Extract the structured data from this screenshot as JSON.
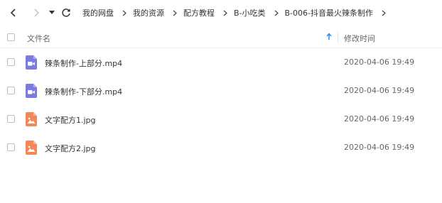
{
  "breadcrumb": [
    "我的网盘",
    "我的资源",
    "配方教程",
    "B-小吃类",
    "B-006-抖音最火辣条制作"
  ],
  "columns": {
    "name": "文件名",
    "modified": "修改时间"
  },
  "files": [
    {
      "name": "辣条制作-上部分.mp4",
      "modified": "2020-04-06 19:49",
      "type": "video"
    },
    {
      "name": "辣条制作-下部分.mp4",
      "modified": "2020-04-06 19:49",
      "type": "video"
    },
    {
      "name": "文字配方1.jpg",
      "modified": "2020-04-06 19:49",
      "type": "image"
    },
    {
      "name": "文字配方2.jpg",
      "modified": "2020-04-06 19:49",
      "type": "image"
    }
  ],
  "colors": {
    "video_icon": "#7b7bdf",
    "image_icon": "#f2875a",
    "sort_arrow": "#3b8fe8"
  }
}
